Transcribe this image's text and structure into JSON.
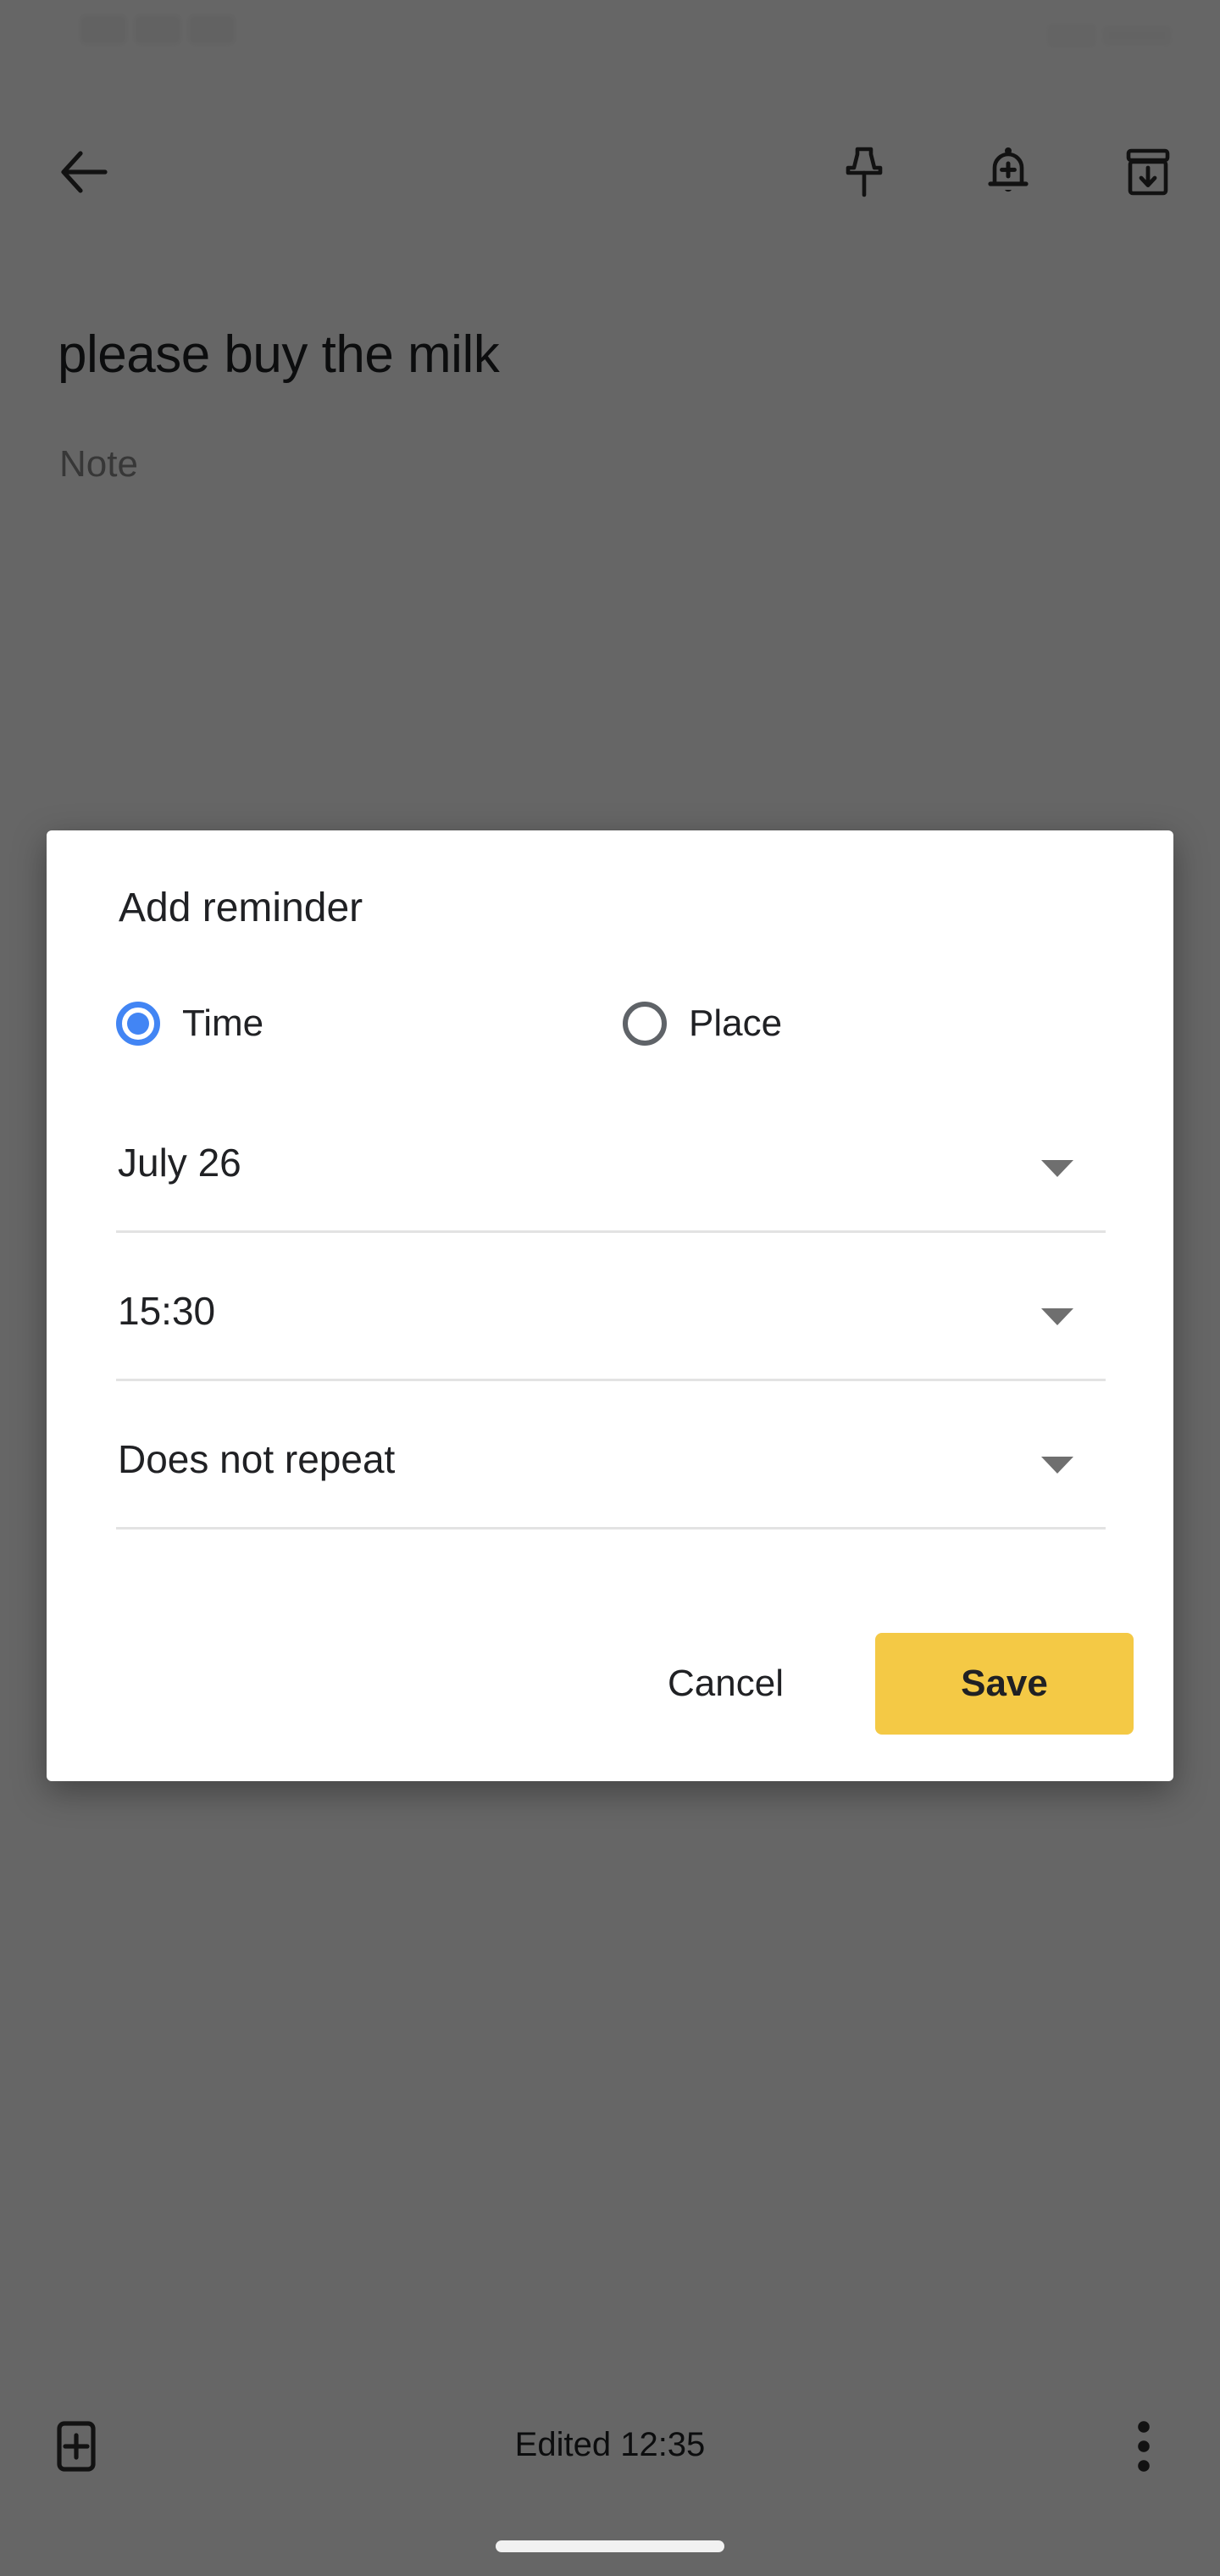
{
  "status_bar": {
    "left_text": ")",
    "icons": [
      {
        "name": "location-pin-icon",
        "glyph": "location"
      },
      {
        "name": "do-not-disturb-icon",
        "glyph": "dnd"
      },
      {
        "name": "wifi-icon",
        "glyph": "wifi"
      },
      {
        "name": "cellular-signal-icon",
        "glyph": "signal"
      },
      {
        "name": "battery-icon",
        "glyph": "battery"
      }
    ]
  },
  "note_screen": {
    "toolbar": {
      "back_label": "back-arrow",
      "pin_label": "pin",
      "reminder_label": "add-reminder-bell",
      "archive_label": "archive"
    },
    "title": "please buy the milk",
    "body_placeholder": "Note",
    "bottom_bar": {
      "add_label": "add-item",
      "edited_text": "Edited 12:35",
      "overflow_label": "more-options"
    }
  },
  "dialog": {
    "title": "Add reminder",
    "radio_options": [
      {
        "label": "Time",
        "selected": true
      },
      {
        "label": "Place",
        "selected": false
      }
    ],
    "fields": [
      {
        "name": "date",
        "value": "July 26"
      },
      {
        "name": "time",
        "value": "15:30"
      },
      {
        "name": "repeat",
        "value": "Does not repeat"
      }
    ],
    "cancel_label": "Cancel",
    "save_label": "Save"
  },
  "colors": {
    "accent_blue": "#4285F4",
    "save_amber": "#F4C945",
    "scrim": "rgba(0,0,0,0.60)",
    "text_primary": "#202124",
    "divider": "#E3E3E3",
    "radio_unselected": "#5F6368"
  }
}
